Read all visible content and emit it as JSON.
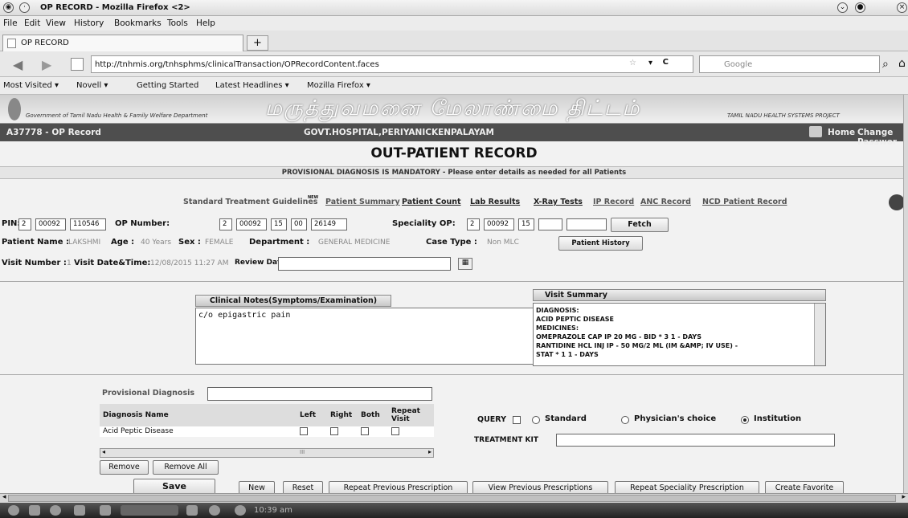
{
  "window": {
    "title": "OP RECORD - Mozilla Firefox <2>"
  },
  "menubar": {
    "items": [
      "File",
      "Edit",
      "View",
      "History",
      "Bookmarks",
      "Tools",
      "Help"
    ]
  },
  "tab": {
    "label": "OP RECORD",
    "new_tab": "+"
  },
  "navbar": {
    "url": "http://tnhmis.org/tnhsphms/clinicalTransaction/OPRecordContent.faces",
    "search_placeholder": "Google"
  },
  "bookmarks": [
    "Most Visited ▾",
    "Novell ▾",
    "Getting Started",
    "Latest Headlines ▾",
    "Mozilla Firefox ▾"
  ],
  "banner": {
    "tamil_text": "மருத்துவமனை மேலாண்மை திட்டம்",
    "gov_text": "Government of Tamil Nadu Health & Family Welfare Department",
    "right_text": "TAMIL NADU HEALTH SYSTEMS PROJECT"
  },
  "header": {
    "record_id": "A37778 - OP Record",
    "hospital": "GOVT.HOSPITAL,PERIYANICKENPALAYAM",
    "home": "Home",
    "change_password": "Change Passwor"
  },
  "page": {
    "title": "OUT-PATIENT RECORD",
    "mandatory": "PROVISIONAL DIAGNOSIS IS MANDATORY - Please enter details as needed for all Patients"
  },
  "links": {
    "stg": "Standard Treatment Guidelines",
    "new_badge": "NEW",
    "items": [
      "Patient Summary",
      "Patient Count",
      "Lab Results",
      "X-Ray Tests",
      "IP Record",
      "ANC Record",
      "NCD Patient Record"
    ]
  },
  "pin": {
    "label": "PIN:",
    "values": [
      "2",
      "00092",
      "110546"
    ]
  },
  "op_number": {
    "label": "OP Number:",
    "values": [
      "2",
      "00092",
      "15",
      "00",
      "26149"
    ]
  },
  "speciality_op": {
    "label": "Speciality OP:",
    "values": [
      "2",
      "00092",
      "15",
      "",
      ""
    ]
  },
  "fetch_label": "Fetch",
  "patient": {
    "name_label": "Patient Name :",
    "name": "LAKSHMI",
    "age_label": "Age :",
    "age": "40 Years",
    "sex_label": "Sex :",
    "sex": "FEMALE",
    "dept_label": "Department :",
    "dept": "GENERAL MEDICINE",
    "case_label": "Case Type :",
    "case": "Non MLC",
    "history_button": "Patient History"
  },
  "visit": {
    "number_label": "Visit Number :",
    "number": "1",
    "datetime_label": "Visit Date&Time:",
    "datetime": "12/08/2015 11:27 AM",
    "review_label": "Review Date:",
    "review_value": ""
  },
  "clinical_notes": {
    "header": "Clinical Notes(Symptoms/Examination)",
    "text": "c/o epigastric pain"
  },
  "visit_summary": {
    "header": "Visit Summary",
    "lines": [
      "DIAGNOSIS:",
      "ACID PEPTIC DISEASE",
      "MEDICINES:",
      "OMEPRAZOLE CAP IP 20 MG - BID * 3 1 - DAYS",
      "RANTIDINE HCL INJ IP - 50 MG/2 ML (IM &AMP; IV USE) -",
      "STAT * 1 1 - DAYS"
    ]
  },
  "provisional_diagnosis": {
    "label": "Provisional Diagnosis",
    "value": ""
  },
  "diagnosis_table": {
    "headers": [
      "Diagnosis Name",
      "Left",
      "Right",
      "Both",
      "Repeat Visit"
    ],
    "rows": [
      {
        "name": "Acid Peptic Disease"
      }
    ],
    "scroll_mark": "III"
  },
  "buttons": {
    "remove": "Remove",
    "remove_all": "Remove All",
    "save": "Save",
    "new": "New",
    "reset": "Reset",
    "repeat_prev": "Repeat Previous Prescription",
    "view_prev": "View Previous Prescriptions",
    "repeat_spec": "Repeat Speciality Prescription",
    "create_fav": "Create Favorite"
  },
  "query": {
    "label": "QUERY",
    "options": [
      "Standard",
      "Physician's choice",
      "Institution"
    ],
    "selected": "Institution"
  },
  "treatment_kit": {
    "label": "TREATMENT KIT",
    "value": ""
  },
  "taskbar": {
    "clock": "10:39 am"
  }
}
